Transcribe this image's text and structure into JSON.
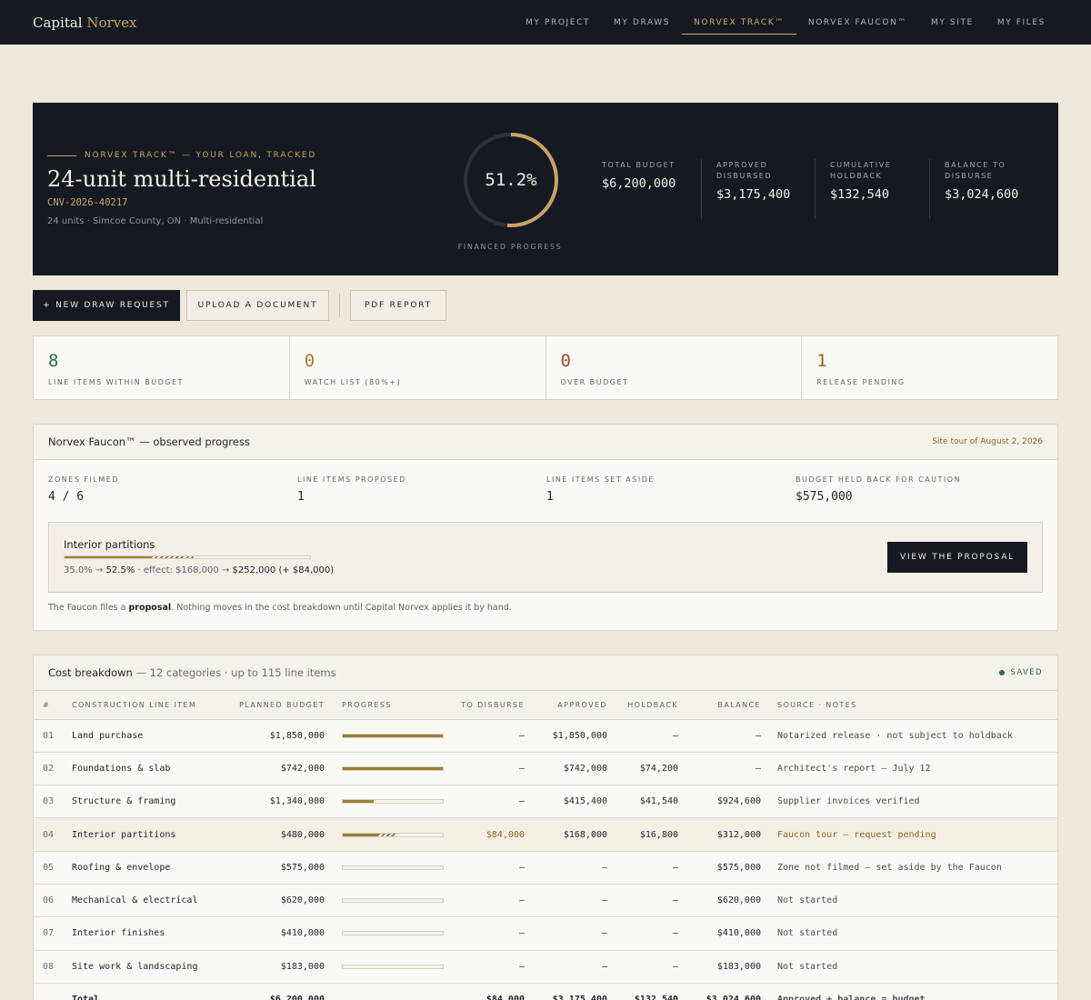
{
  "brand": {
    "name_part1": "Capital",
    "name_part2": "Norvex"
  },
  "nav": [
    {
      "label": "MY PROJECT",
      "active": false
    },
    {
      "label": "MY DRAWS",
      "active": false
    },
    {
      "label": "NORVEX TRACK™",
      "active": true
    },
    {
      "label": "NORVEX FAUCON™",
      "active": false
    },
    {
      "label": "MY SITE",
      "active": false
    },
    {
      "label": "MY FILES",
      "active": false
    }
  ],
  "hero": {
    "eyebrow": "NORVEX TRACK™ — YOUR LOAN, TRACKED",
    "title": "24-unit multi-residential",
    "ref": "CNV-2026-40217",
    "meta": "24 units · Simcoe County, ON · Multi-residential",
    "progress_value": "51.2%",
    "progress_fraction": 0.512,
    "progress_label": "FINANCED PROGRESS",
    "stats": [
      {
        "label_l1": "TOTAL BUDGET",
        "label_l2": "",
        "value": "$6,200,000"
      },
      {
        "label_l1": "APPROVED",
        "label_l2": "DISBURSED",
        "value": "$3,175,400"
      },
      {
        "label_l1": "CUMULATIVE",
        "label_l2": "HOLDBACK",
        "value": "$132,540"
      },
      {
        "label_l1": "BALANCE TO",
        "label_l2": "DISBURSE",
        "value": "$3,024,600"
      }
    ]
  },
  "actions": {
    "new_draw": "+ NEW DRAW REQUEST",
    "upload": "UPLOAD A DOCUMENT",
    "pdf": "PDF REPORT"
  },
  "kpis": [
    {
      "value": "8",
      "label": "LINE ITEMS WITHIN BUDGET",
      "color": "#2e6a4a"
    },
    {
      "value": "0",
      "label": "WATCH LIST (80%+)",
      "color": "#9c7f36"
    },
    {
      "value": "0",
      "label": "OVER BUDGET",
      "color": "#a8442f"
    },
    {
      "value": "1",
      "label": "RELEASE PENDING",
      "color": "#8a6a22"
    }
  ],
  "faucon": {
    "title": "Norvex Faucon™ — observed progress",
    "tour": "Site tour of August 2, 2026",
    "stats": [
      {
        "label": "ZONES FILMED",
        "value": "4 / 6"
      },
      {
        "label": "LINE ITEMS PROPOSED",
        "value": "1"
      },
      {
        "label": "LINE ITEMS SET ASIDE",
        "value": "1"
      },
      {
        "label": "BUDGET HELD BACK FOR CAUTION",
        "value": "$575,000"
      }
    ],
    "proposal": {
      "item": "Interior partitions",
      "from_pct": "35.0%",
      "to_pct": "52.5%",
      "from_fraction": 0.35,
      "to_fraction": 0.525,
      "effect_prefix": "· effect:",
      "from_amount": "$168,000",
      "to_amount": "$252,000",
      "delta": "(+ $84,000)",
      "button": "VIEW THE PROPOSAL"
    },
    "footnote_pre": "The Faucon files a",
    "footnote_bold": "proposal",
    "footnote_post": ". Nothing moves in the cost breakdown until Capital Norvex applies it by hand."
  },
  "cost": {
    "title": "Cost breakdown",
    "subtitle": "— 12 categories · up to 115 line items",
    "status": "SAVED",
    "columns": [
      "#",
      "CONSTRUCTION LINE ITEM",
      "PLANNED BUDGET",
      "PROGRESS",
      "TO DISBURSE",
      "APPROVED",
      "HOLDBACK",
      "BALANCE",
      "SOURCE · NOTES"
    ],
    "rows": [
      {
        "num": "01",
        "item": "Land purchase",
        "budget": "$1,850,000",
        "progress": 1.0,
        "pending": 0,
        "to_disburse": "—",
        "approved": "$1,850,000",
        "holdback": "—",
        "balance": "—",
        "note": "Notarized release · not subject to holdback",
        "highlight": false
      },
      {
        "num": "02",
        "item": "Foundations & slab",
        "budget": "$742,000",
        "progress": 1.0,
        "pending": 0,
        "to_disburse": "—",
        "approved": "$742,000",
        "holdback": "$74,200",
        "balance": "—",
        "note": "Architect's report — July 12",
        "highlight": false
      },
      {
        "num": "03",
        "item": "Structure & framing",
        "budget": "$1,340,000",
        "progress": 0.31,
        "pending": 0,
        "to_disburse": "—",
        "approved": "$415,400",
        "holdback": "$41,540",
        "balance": "$924,600",
        "note": "Supplier invoices verified",
        "highlight": false
      },
      {
        "num": "04",
        "item": "Interior partitions",
        "budget": "$480,000",
        "progress": 0.35,
        "pending": 0.525,
        "to_disburse": "$84,000",
        "approved": "$168,000",
        "holdback": "$16,800",
        "balance": "$312,000",
        "note": "Faucon tour — request pending",
        "highlight": true
      },
      {
        "num": "05",
        "item": "Roofing & envelope",
        "budget": "$575,000",
        "progress": 0,
        "pending": 0,
        "to_disburse": "—",
        "approved": "—",
        "holdback": "—",
        "balance": "$575,000",
        "note": "Zone not filmed — set aside by the Faucon",
        "highlight": false
      },
      {
        "num": "06",
        "item": "Mechanical & electrical",
        "budget": "$620,000",
        "progress": 0,
        "pending": 0,
        "to_disburse": "—",
        "approved": "—",
        "holdback": "—",
        "balance": "$620,000",
        "note": "Not started",
        "highlight": false
      },
      {
        "num": "07",
        "item": "Interior finishes",
        "budget": "$410,000",
        "progress": 0,
        "pending": 0,
        "to_disburse": "—",
        "approved": "—",
        "holdback": "—",
        "balance": "$410,000",
        "note": "Not started",
        "highlight": false
      },
      {
        "num": "08",
        "item": "Site work & landscaping",
        "budget": "$183,000",
        "progress": 0,
        "pending": 0,
        "to_disburse": "—",
        "approved": "—",
        "holdback": "—",
        "balance": "$183,000",
        "note": "Not started",
        "highlight": false
      }
    ],
    "total": {
      "label": "Total",
      "budget": "$6,200,000",
      "to_disburse": "$84,000",
      "approved": "$3,175,400",
      "holdback": "$132,540",
      "balance": "$3,024,600",
      "note": "Approved + balance = budget"
    }
  }
}
